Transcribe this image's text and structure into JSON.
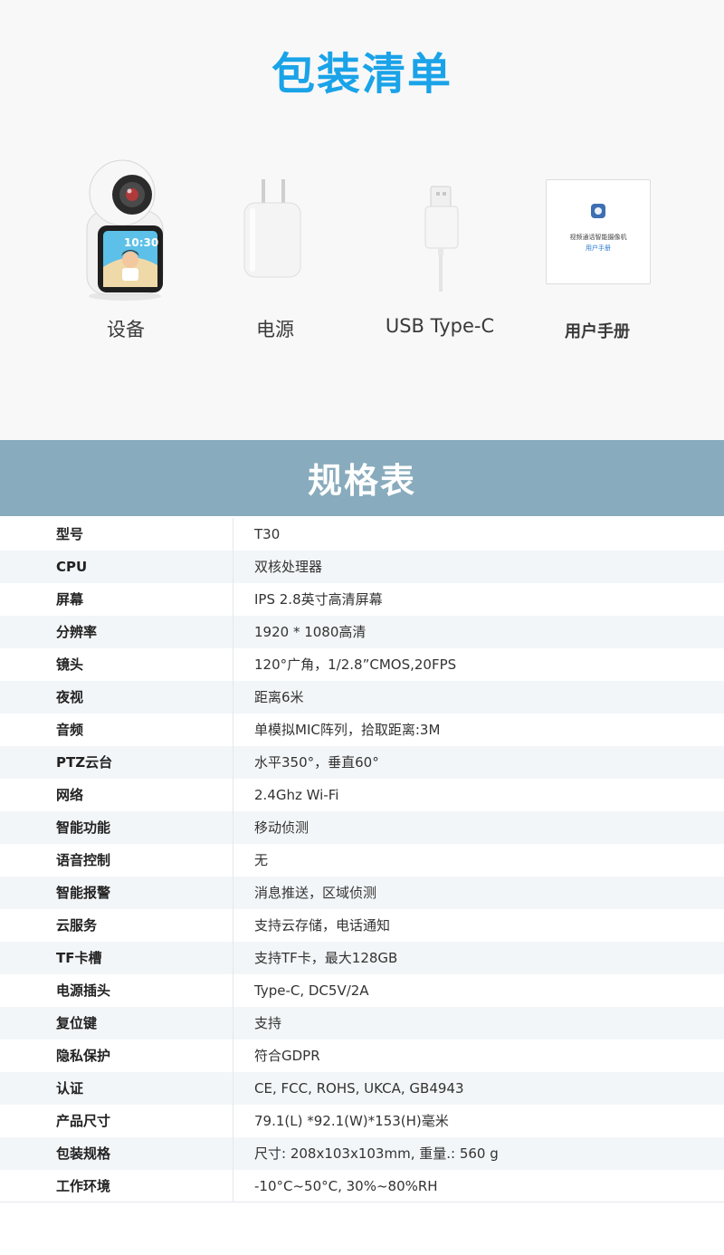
{
  "pack": {
    "title": "包装清单",
    "items": [
      {
        "label": "设备"
      },
      {
        "label": "电源"
      },
      {
        "label": "USB Type-C"
      },
      {
        "label": "用户手册"
      }
    ],
    "device_screen_time": "10:30",
    "manual_text": {
      "line1": "视频通话智能摄像机",
      "line2": "用户手册"
    }
  },
  "spec": {
    "title": "规格表",
    "rows": [
      {
        "key": "型号",
        "value": "T30"
      },
      {
        "key": "CPU",
        "value": "双核处理器"
      },
      {
        "key": "屏幕",
        "value": "IPS 2.8英寸高清屏幕"
      },
      {
        "key": "分辨率",
        "value": "1920 * 1080高清"
      },
      {
        "key": "镜头",
        "value": "120°广角，1/2.8”CMOS,20FPS"
      },
      {
        "key": "夜视",
        "value": "距离6米"
      },
      {
        "key": "音频",
        "value": "单模拟MIC阵列，拾取距离:3M"
      },
      {
        "key": "PTZ云台",
        "value": "水平350°，垂直60°"
      },
      {
        "key": "网络",
        "value": "2.4Ghz Wi-Fi"
      },
      {
        "key": "智能功能",
        "value": "移动侦测"
      },
      {
        "key": "语音控制",
        "value": "无"
      },
      {
        "key": "智能报警",
        "value": "消息推送，区域侦测"
      },
      {
        "key": "云服务",
        "value": "支持云存储，电话通知"
      },
      {
        "key": "TF卡槽",
        "value": "支持TF卡，最大128GB"
      },
      {
        "key": "电源插头",
        "value": "Type-C, DC5V/2A"
      },
      {
        "key": "复位键",
        "value": "支持"
      },
      {
        "key": "隐私保护",
        "value": "符合GDPR"
      },
      {
        "key": "认证",
        "value": "CE, FCC, ROHS, UKCA, GB4943"
      },
      {
        "key": "产品尺寸",
        "value": "79.1(L) *92.1(W)*153(H)毫米"
      },
      {
        "key": "包装规格",
        "value": "尺寸: 208x103x103mm, 重量.: 560 g"
      },
      {
        "key": "工作环境",
        "value": "-10°C~50°C, 30%~80%RH"
      }
    ]
  },
  "colors": {
    "title_blue": "#1aa3e8",
    "banner": "#88abbd"
  }
}
